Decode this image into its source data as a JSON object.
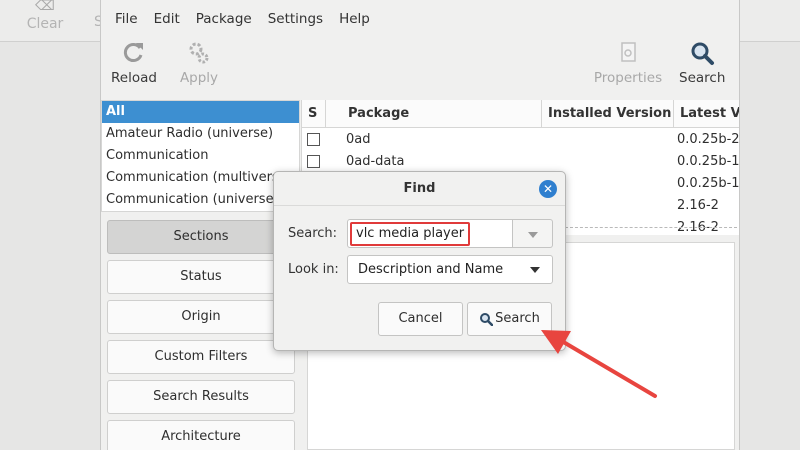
{
  "background": {
    "clear_label": "Clear",
    "s_label": "S"
  },
  "menu": [
    "File",
    "Edit",
    "Package",
    "Settings",
    "Help"
  ],
  "toolbar": {
    "reload": "Reload",
    "apply": "Apply",
    "properties": "Properties",
    "search": "Search"
  },
  "sections": {
    "items": [
      {
        "label": "All",
        "selected": true
      },
      {
        "label": "Amateur Radio (universe)"
      },
      {
        "label": "Communication"
      },
      {
        "label": "Communication (multiverse)"
      },
      {
        "label": "Communication (universe)"
      }
    ]
  },
  "filters": [
    "Sections",
    "Status",
    "Origin",
    "Custom Filters",
    "Search Results",
    "Architecture"
  ],
  "table": {
    "headers": [
      "S",
      "Package",
      "Installed Version",
      "Latest Ver"
    ],
    "rows": [
      {
        "package": "0ad",
        "latest": "0.0.25b-2"
      },
      {
        "package": "0ad-data",
        "latest": "0.0.25b-1"
      },
      {
        "package": "",
        "latest": "0.0.25b-1"
      },
      {
        "package": "",
        "latest": "2.16-2"
      },
      {
        "package": "",
        "latest": "2.16-2"
      }
    ]
  },
  "dialog": {
    "title": "Find",
    "search_label": "Search:",
    "search_value": "vlc media player",
    "lookin_label": "Look in:",
    "lookin_value": "Description and Name",
    "cancel": "Cancel",
    "search_button": "Search"
  },
  "colors": {
    "selection": "#3d8fd1",
    "annotation": "#e03a3a",
    "close": "#2f7fcf"
  }
}
